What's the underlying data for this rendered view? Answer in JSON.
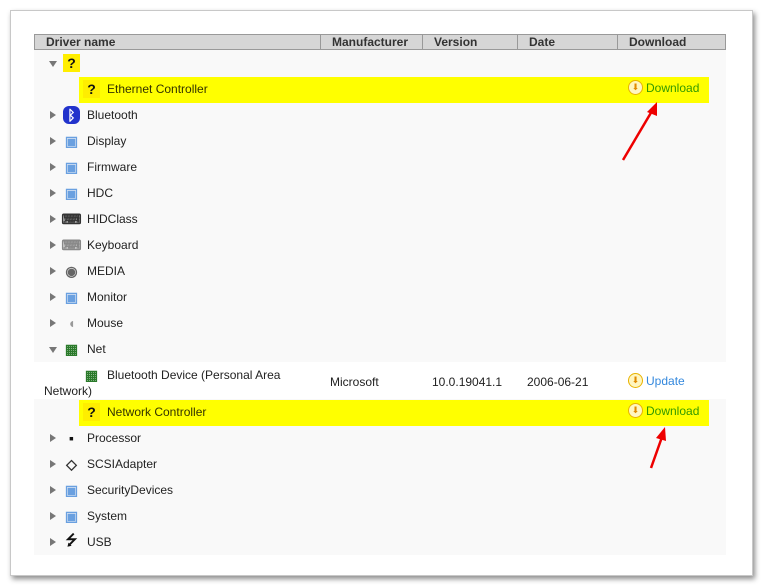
{
  "header": {
    "driver_name": "Driver name",
    "manufacturer": "Manufacturer",
    "version": "Version",
    "date": "Date",
    "download": "Download"
  },
  "colors": {
    "highlight": "#ffff00",
    "download_link": "#339900",
    "update_link": "#3388dd",
    "arrow": "#ee0000"
  },
  "rows": [
    {
      "kind": "group",
      "expanded": true,
      "icon": "question-icon",
      "label": ""
    },
    {
      "kind": "device",
      "highlight": true,
      "icon": "question-icon",
      "label": "Ethernet Controller",
      "action": "Download"
    },
    {
      "kind": "group",
      "icon": "bluetooth-icon",
      "label": "Bluetooth"
    },
    {
      "kind": "group",
      "icon": "monitor-icon",
      "label": "Display"
    },
    {
      "kind": "group",
      "icon": "monitor-icon",
      "label": "Firmware"
    },
    {
      "kind": "group",
      "icon": "monitor-icon",
      "label": "HDC"
    },
    {
      "kind": "group",
      "icon": "hid-icon",
      "label": "HIDClass"
    },
    {
      "kind": "group",
      "icon": "keyboard-icon",
      "label": "Keyboard"
    },
    {
      "kind": "group",
      "icon": "media-icon",
      "label": "MEDIA"
    },
    {
      "kind": "group",
      "icon": "monitor-icon",
      "label": "Monitor"
    },
    {
      "kind": "group",
      "icon": "mouse-icon",
      "label": "Mouse"
    },
    {
      "kind": "group",
      "expanded": true,
      "icon": "network-card-icon",
      "label": "Net"
    },
    {
      "kind": "device",
      "tall": true,
      "icon": "network-card-icon",
      "label": "Bluetooth Device (Personal Area",
      "label2": "Network)",
      "manufacturer": "Microsoft",
      "version": "10.0.19041.1",
      "date": "2006-06-21",
      "action": "Update"
    },
    {
      "kind": "device",
      "highlight": true,
      "icon": "question-icon",
      "label": "Network Controller",
      "action": "Download"
    },
    {
      "kind": "group",
      "icon": "processor-icon",
      "label": "Processor"
    },
    {
      "kind": "group",
      "icon": "scsi-icon",
      "label": "SCSIAdapter"
    },
    {
      "kind": "group",
      "icon": "monitor-icon",
      "label": "SecurityDevices"
    },
    {
      "kind": "group",
      "icon": "monitor-icon",
      "label": "System"
    },
    {
      "kind": "group",
      "icon": "usb-icon",
      "label": "USB"
    }
  ]
}
